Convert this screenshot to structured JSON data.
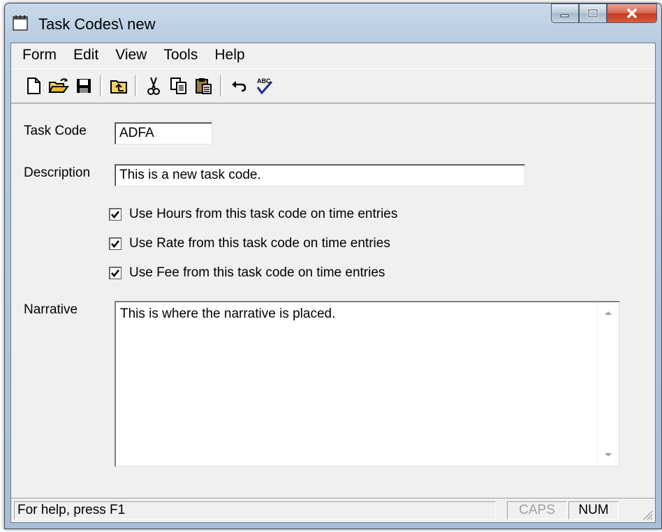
{
  "window": {
    "title": "Task Codes\\ new",
    "buttons": {
      "minimize": "minimize",
      "maximize": "maximize",
      "close": "close"
    }
  },
  "menu": {
    "items": [
      "Form",
      "Edit",
      "View",
      "Tools",
      "Help"
    ]
  },
  "toolbar": {
    "buttons": [
      {
        "name": "new-icon"
      },
      {
        "name": "open-icon"
      },
      {
        "name": "save-icon"
      },
      {
        "name": "up-folder-icon"
      },
      {
        "name": "cut-icon"
      },
      {
        "name": "copy-icon"
      },
      {
        "name": "paste-icon"
      },
      {
        "name": "undo-icon"
      },
      {
        "name": "spellcheck-icon"
      }
    ]
  },
  "form": {
    "task_code": {
      "label": "Task Code",
      "value": "ADFA"
    },
    "description": {
      "label": "Description",
      "value": "This is a new task code."
    },
    "options": [
      {
        "label": "Use Hours from this task code on time entries",
        "checked": true
      },
      {
        "label": "Use Rate from this task code on time entries",
        "checked": true
      },
      {
        "label": "Use Fee from this task code on time entries",
        "checked": true
      }
    ],
    "narrative": {
      "label": "Narrative",
      "value": "This is where the narrative is placed."
    }
  },
  "status": {
    "text": "For help, press F1",
    "caps": "CAPS",
    "num": "NUM"
  },
  "colors": {
    "title_gradient": "#b6cbe0",
    "close_button": "#c2391f",
    "client_bg": "#f0f0f0"
  }
}
